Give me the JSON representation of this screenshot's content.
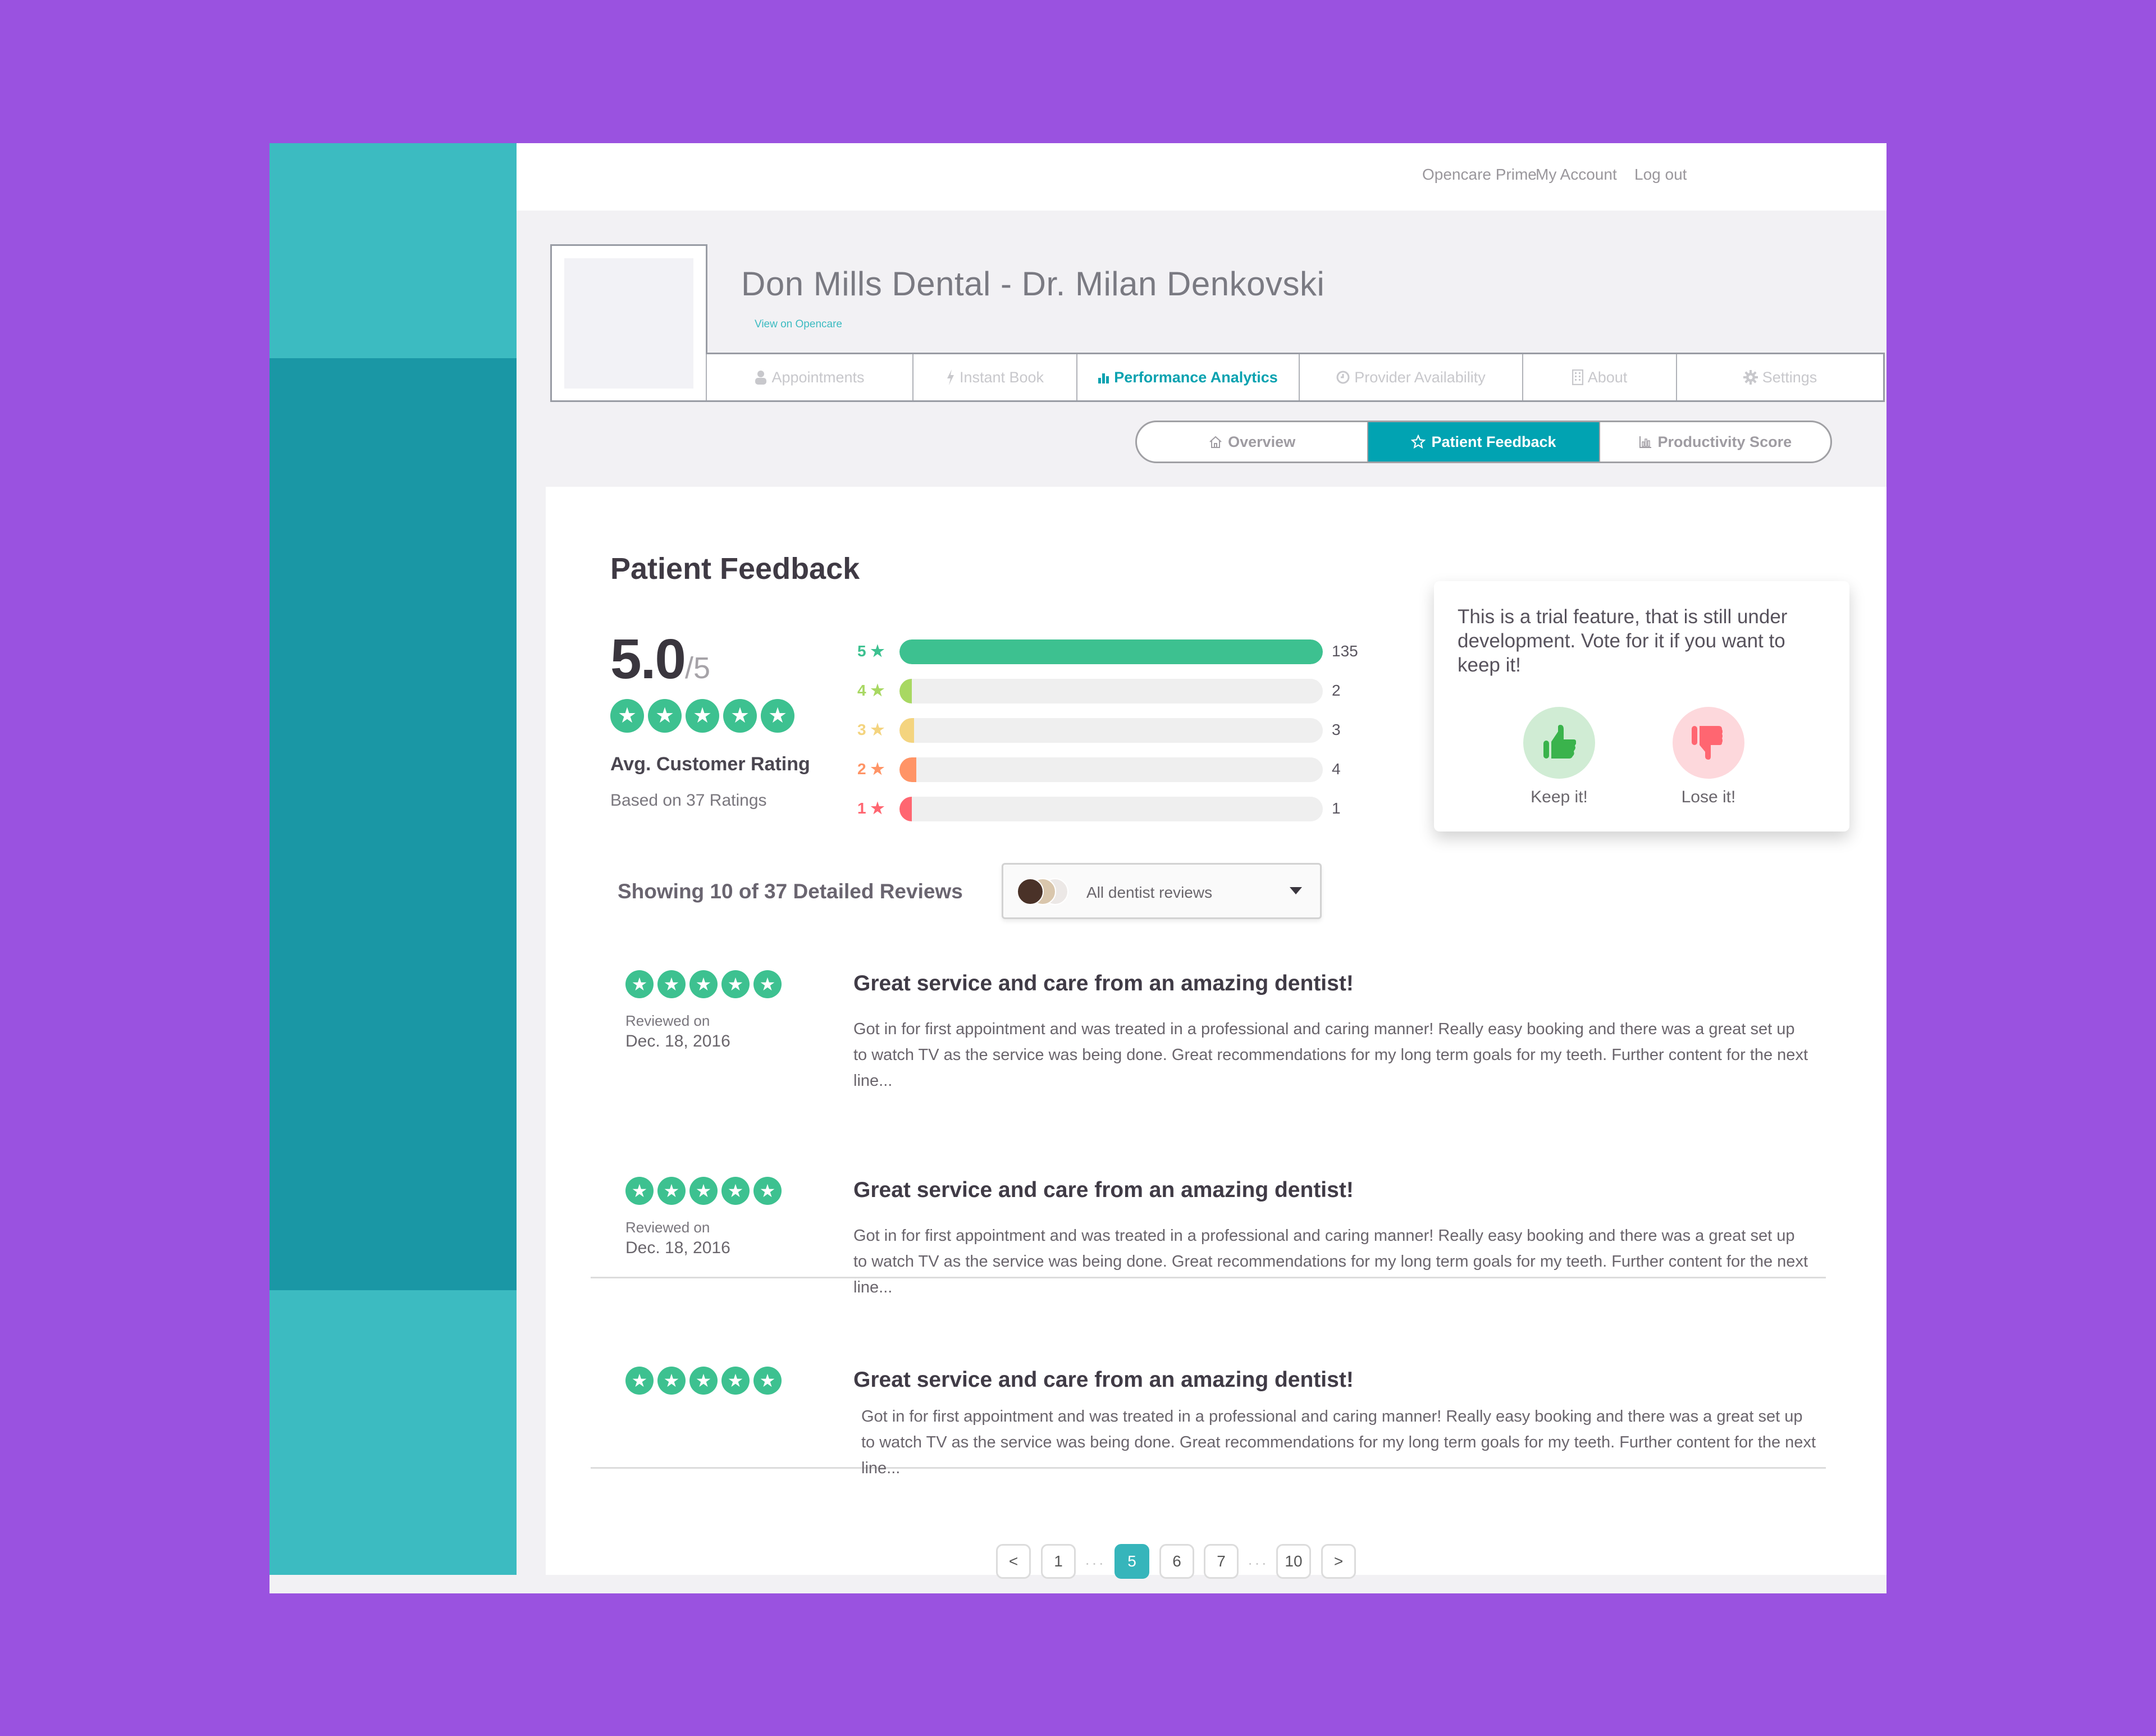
{
  "topbar": {
    "links": [
      "Opencare Prime",
      "My Account",
      "Log out"
    ]
  },
  "profile": {
    "name": "Don Mills Dental - Dr. Milan Denkovski",
    "link": "View on Opencare"
  },
  "nav": {
    "tabs": [
      {
        "label": "Appointments",
        "icon": "user-icon",
        "active": false
      },
      {
        "label": "Instant Book",
        "icon": "lightning-icon",
        "active": false
      },
      {
        "label": "Performance Analytics",
        "icon": "bar-chart-icon",
        "active": true
      },
      {
        "label": "Provider Availability",
        "icon": "clock-icon",
        "active": false
      },
      {
        "label": "About",
        "icon": "building-icon",
        "active": false
      },
      {
        "label": "Settings",
        "icon": "gear-icon",
        "active": false
      }
    ]
  },
  "subnav": {
    "tabs": [
      {
        "label": "Overview",
        "icon": "home-icon",
        "active": false
      },
      {
        "label": "Patient Feedback",
        "icon": "star-outline-icon",
        "active": true
      },
      {
        "label": "Productivity Score",
        "icon": "bar-chart-outline-icon",
        "active": false
      }
    ]
  },
  "feedback": {
    "title": "Patient Feedback",
    "avg_score": "5.0",
    "avg_denominator": "/5",
    "avg_stars": 5,
    "avg_label": "Avg. Customer Rating",
    "avg_sub": "Based on 37 Ratings",
    "distribution": [
      {
        "label": "5",
        "count": "135",
        "fill": 1.0,
        "color": "#3dc190"
      },
      {
        "label": "4",
        "count": "2",
        "fill": 0.027,
        "color": "#a8d862"
      },
      {
        "label": "3",
        "count": "3",
        "fill": 0.035,
        "color": "#f4d47f"
      },
      {
        "label": "2",
        "count": "4",
        "fill": 0.04,
        "color": "#ff9466"
      },
      {
        "label": "1",
        "count": "1",
        "fill": 0.013,
        "color": "#ff6671"
      }
    ]
  },
  "trial": {
    "text": "This is a trial feature, that is still under development. Vote for it if you want to keep it!",
    "keep_label": "Keep it!",
    "lose_label": "Lose it!"
  },
  "reviews_header": {
    "showing": "Showing 10 of 37 Detailed Reviews",
    "filter_value": "All dentist reviews"
  },
  "reviews": [
    {
      "stars": 5,
      "reviewed_on": "Reviewed on",
      "date": "Dec. 18, 2016",
      "title": "Great service and care from an amazing dentist!",
      "body": "Got in for first appointment and was treated in a professional and caring manner! Really easy booking and there was a great set up to watch TV as the service was being done. Great recommendations for my long term goals for my teeth. Further content for the next line..."
    },
    {
      "stars": 5,
      "reviewed_on": "Reviewed on",
      "date": "Dec. 18, 2016",
      "title": "Great service and care from an amazing dentist!",
      "body": "Got in for first appointment and was treated in a professional and caring manner! Really easy booking and there was a great set up to watch TV as the service was being done. Great recommendations for my long term goals for my teeth. Further content for the next line..."
    },
    {
      "stars": 5,
      "reviewed_on": "",
      "date": "",
      "title": "Great service and care from an amazing dentist!",
      "body": "Got in for first appointment and was treated in a professional and caring manner! Really easy booking and there was a great set up to watch TV as the service was being done. Great recommendations for my long term goals for my teeth. Further content for the next line..."
    }
  ],
  "pagination": {
    "prev": "<",
    "next": ">",
    "pages": [
      "1",
      "5",
      "6",
      "7",
      "10"
    ],
    "current": "5",
    "ellipsis": "···"
  }
}
